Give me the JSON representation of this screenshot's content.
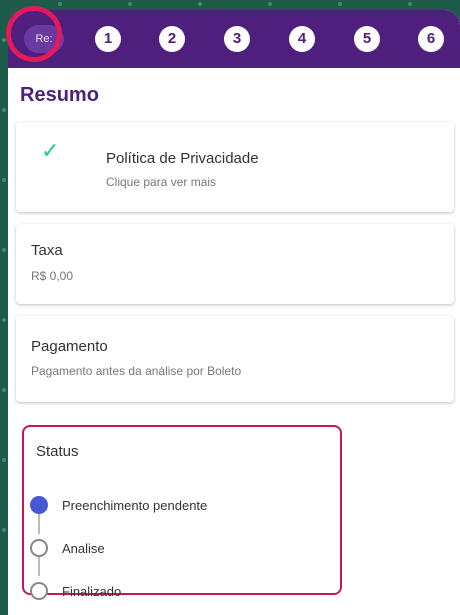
{
  "steps": {
    "current_label": "Re:",
    "items": [
      "1",
      "2",
      "3",
      "4",
      "5",
      "6"
    ]
  },
  "page": {
    "title": "Resumo"
  },
  "privacy": {
    "title": "Política de Privacidade",
    "subtitle": "Clique para ver mais"
  },
  "fee": {
    "title": "Taxa",
    "value": "R$ 0,00"
  },
  "payment": {
    "title": "Pagamento",
    "value": "Pagamento antes da análise por Boleto"
  },
  "status": {
    "title": "Status",
    "options": [
      {
        "label": "Preenchimento pendente",
        "active": true
      },
      {
        "label": "Analise",
        "active": false
      },
      {
        "label": "Finalizado",
        "active": false
      }
    ]
  },
  "colors": {
    "brand": "#4f1f7e",
    "highlight": "#e2195b",
    "check": "#27c49a",
    "active_step": "#4758d6",
    "background": "#1d5a4a"
  }
}
